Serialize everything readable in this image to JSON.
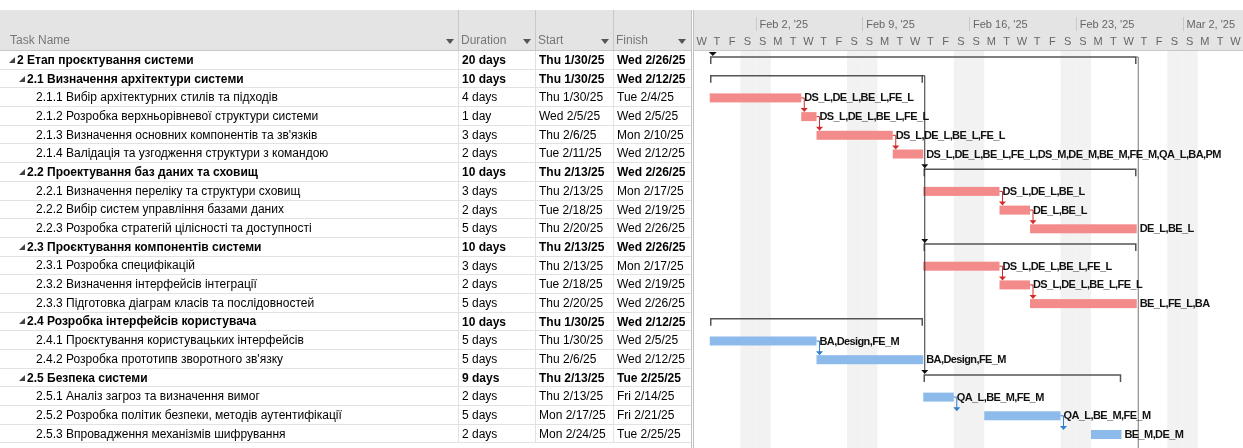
{
  "table": {
    "columns": [
      {
        "label": "Task Name"
      },
      {
        "label": "Duration"
      },
      {
        "label": "Start"
      },
      {
        "label": "Finish"
      }
    ]
  },
  "timeline": {
    "weeks": [
      {
        "label": "Feb 2, '25"
      },
      {
        "label": "Feb 9, '25"
      },
      {
        "label": "Feb 16, '25"
      },
      {
        "label": "Feb 23, '25"
      },
      {
        "label": "Mar 2, '25"
      }
    ],
    "days": [
      "W",
      "T",
      "F",
      "S",
      "S",
      "M",
      "T",
      "W",
      "T",
      "F",
      "S",
      "S",
      "M",
      "T",
      "W",
      "T",
      "F",
      "S",
      "S",
      "M",
      "T",
      "W",
      "T",
      "F",
      "S",
      "S",
      "M",
      "T",
      "W",
      "T",
      "F",
      "S",
      "S",
      "M",
      "T",
      "W"
    ]
  },
  "tasks": [
    {
      "name": "2 Етап проєктування системи",
      "duration": "20 days",
      "start": "Thu 1/30/25",
      "finish": "Wed 2/26/25",
      "expanded": true,
      "children": [
        {
          "name": "2.1 Визначення архітектури системи",
          "duration": "10 days",
          "start": "Thu 1/30/25",
          "finish": "Wed 2/12/25",
          "expanded": true,
          "children": [
            {
              "name": "2.1.1 Вибір архітектурних стилів та підходів",
              "duration": "4 days",
              "start": "Thu 1/30/25",
              "finish": "Tue 2/4/25",
              "critical": true,
              "resources": "DS_L,DE_L,BE_L,FE_L"
            },
            {
              "name": "2.1.2 Розробка верхньорівневої структури системи",
              "duration": "1 day",
              "start": "Wed 2/5/25",
              "finish": "Wed 2/5/25",
              "critical": true,
              "resources": "DS_L,DE_L,BE_L,FE_L"
            },
            {
              "name": "2.1.3 Визначення основних компонентів та зв'язків",
              "duration": "3 days",
              "start": "Thu 2/6/25",
              "finish": "Mon 2/10/25",
              "critical": true,
              "resources": "DS_L,DE_L,BE_L,FE_L"
            },
            {
              "name": "2.1.4 Валідація та узгодження структури з командою",
              "duration": "2 days",
              "start": "Tue 2/11/25",
              "finish": "Wed 2/12/25",
              "critical": true,
              "resources": "DS_L,DE_L,BE_L,FE_L,DS_M,DE_M,BE_M,FE_M,QA_L,BA,PM"
            }
          ]
        },
        {
          "name": "2.2 Проектування баз даних та сховищ",
          "duration": "10 days",
          "start": "Thu 2/13/25",
          "finish": "Wed 2/26/25",
          "expanded": true,
          "children": [
            {
              "name": "2.2.1 Визначення переліку та структури сховищ",
              "duration": "3 days",
              "start": "Thu 2/13/25",
              "finish": "Mon 2/17/25",
              "critical": true,
              "resources": "DS_L,DE_L,BE_L"
            },
            {
              "name": "2.2.2 Вибір систем управління базами даних",
              "duration": "2 days",
              "start": "Tue 2/18/25",
              "finish": "Wed 2/19/25",
              "critical": true,
              "resources": "DE_L,BE_L"
            },
            {
              "name": "2.2.3 Розробка стратегій цілісності та доступності",
              "duration": "5 days",
              "start": "Thu 2/20/25",
              "finish": "Wed 2/26/25",
              "critical": true,
              "resources": "DE_L,BE_L"
            }
          ]
        },
        {
          "name": "2.3 Проєктування компонентів системи",
          "duration": "10 days",
          "start": "Thu 2/13/25",
          "finish": "Wed 2/26/25",
          "expanded": true,
          "children": [
            {
              "name": "2.3.1 Розробка специфікацій",
              "duration": "3 days",
              "start": "Thu 2/13/25",
              "finish": "Mon 2/17/25",
              "critical": true,
              "resources": "DS_L,DE_L,BE_L,FE_L"
            },
            {
              "name": "2.3.2 Визначення інтерфейсів інтеграції",
              "duration": "2 days",
              "start": "Tue 2/18/25",
              "finish": "Wed 2/19/25",
              "critical": true,
              "resources": "DS_L,DE_L,BE_L,FE_L"
            },
            {
              "name": "2.3.3 Підготовка діаграм класів та послідовностей",
              "duration": "5 days",
              "start": "Thu 2/20/25",
              "finish": "Wed 2/26/25",
              "critical": true,
              "resources": "BE_L,FE_L,BA"
            }
          ]
        },
        {
          "name": "2.4 Розробка інтерфейсів користувача",
          "duration": "10 days",
          "start": "Thu 1/30/25",
          "finish": "Wed 2/12/25",
          "expanded": true,
          "children": [
            {
              "name": "2.4.1 Проєктування користувацьких інтерфейсів",
              "duration": "5 days",
              "start": "Thu 1/30/25",
              "finish": "Wed 2/5/25",
              "critical": false,
              "resources": "BA,Design,FE_M"
            },
            {
              "name": "2.4.2 Розробка прототипв зворотного зв'язку",
              "duration": "5 days",
              "start": "Thu 2/6/25",
              "finish": "Wed 2/12/25",
              "critical": false,
              "resources": "BA,Design,FE_M"
            }
          ]
        },
        {
          "name": "2.5 Безпека системи",
          "duration": "9 days",
          "start": "Thu 2/13/25",
          "finish": "Tue 2/25/25",
          "expanded": true,
          "children": [
            {
              "name": "2.5.1 Аналіз загроз та визначення вимог",
              "duration": "2 days",
              "start": "Thu 2/13/25",
              "finish": "Fri 2/14/25",
              "critical": false,
              "resources": "QA_L,BE_M,FE_M"
            },
            {
              "name": "2.5.2 Розробка політик безпеки, методів аутентифікації",
              "duration": "5 days",
              "start": "Mon 2/17/25",
              "finish": "Fri 2/21/25",
              "critical": false,
              "resources": "QA_L,BE_M,FE_M"
            },
            {
              "name": "2.5.3 Впровадження механізмів шифрування",
              "duration": "2 days",
              "start": "Mon 2/24/25",
              "finish": "Tue 2/25/25",
              "critical": false,
              "resources": "BE_M,DE_M"
            }
          ]
        }
      ]
    }
  ]
}
